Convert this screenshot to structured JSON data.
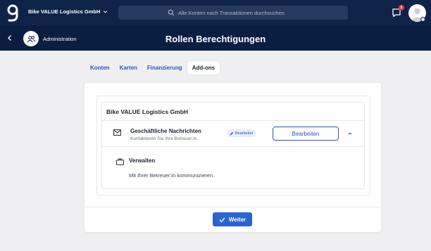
{
  "header": {
    "company_name": "Bike VALUE Logistics GmbH",
    "search_placeholder": "Alle Konten nach Transaktionen durchsuchen",
    "notification_count": "2"
  },
  "subheader": {
    "back_icon": "chevron-left-icon",
    "section_label": "Administration",
    "page_title": "Rollen Berechtigungen"
  },
  "tabs": [
    {
      "label": "Konten",
      "active": false
    },
    {
      "label": "Karten",
      "active": false
    },
    {
      "label": "Finanzierung",
      "active": false
    },
    {
      "label": "Add-ons",
      "active": true
    }
  ],
  "card": {
    "company_title": "Bike VALUE Logistics GmbH",
    "permission": {
      "icon": "mail-icon",
      "title": "Geschäftliche Nachrichten",
      "subtitle": "Kontaktieren Sie Ihre Betreuer:in.",
      "status": "Bearbeitet",
      "edit_label": "Bearbeiten"
    },
    "detail": {
      "icon": "briefcase-icon",
      "title": "Verwalten",
      "description": "Mit Ihrer Betreuer:in kommunizieren."
    },
    "next_label": "Weiter"
  },
  "colors": {
    "topbar": "#0f2349",
    "subheader": "#0a1e42",
    "accent": "#2a63d2",
    "link": "#2a56b8",
    "background": "#efeff1"
  }
}
